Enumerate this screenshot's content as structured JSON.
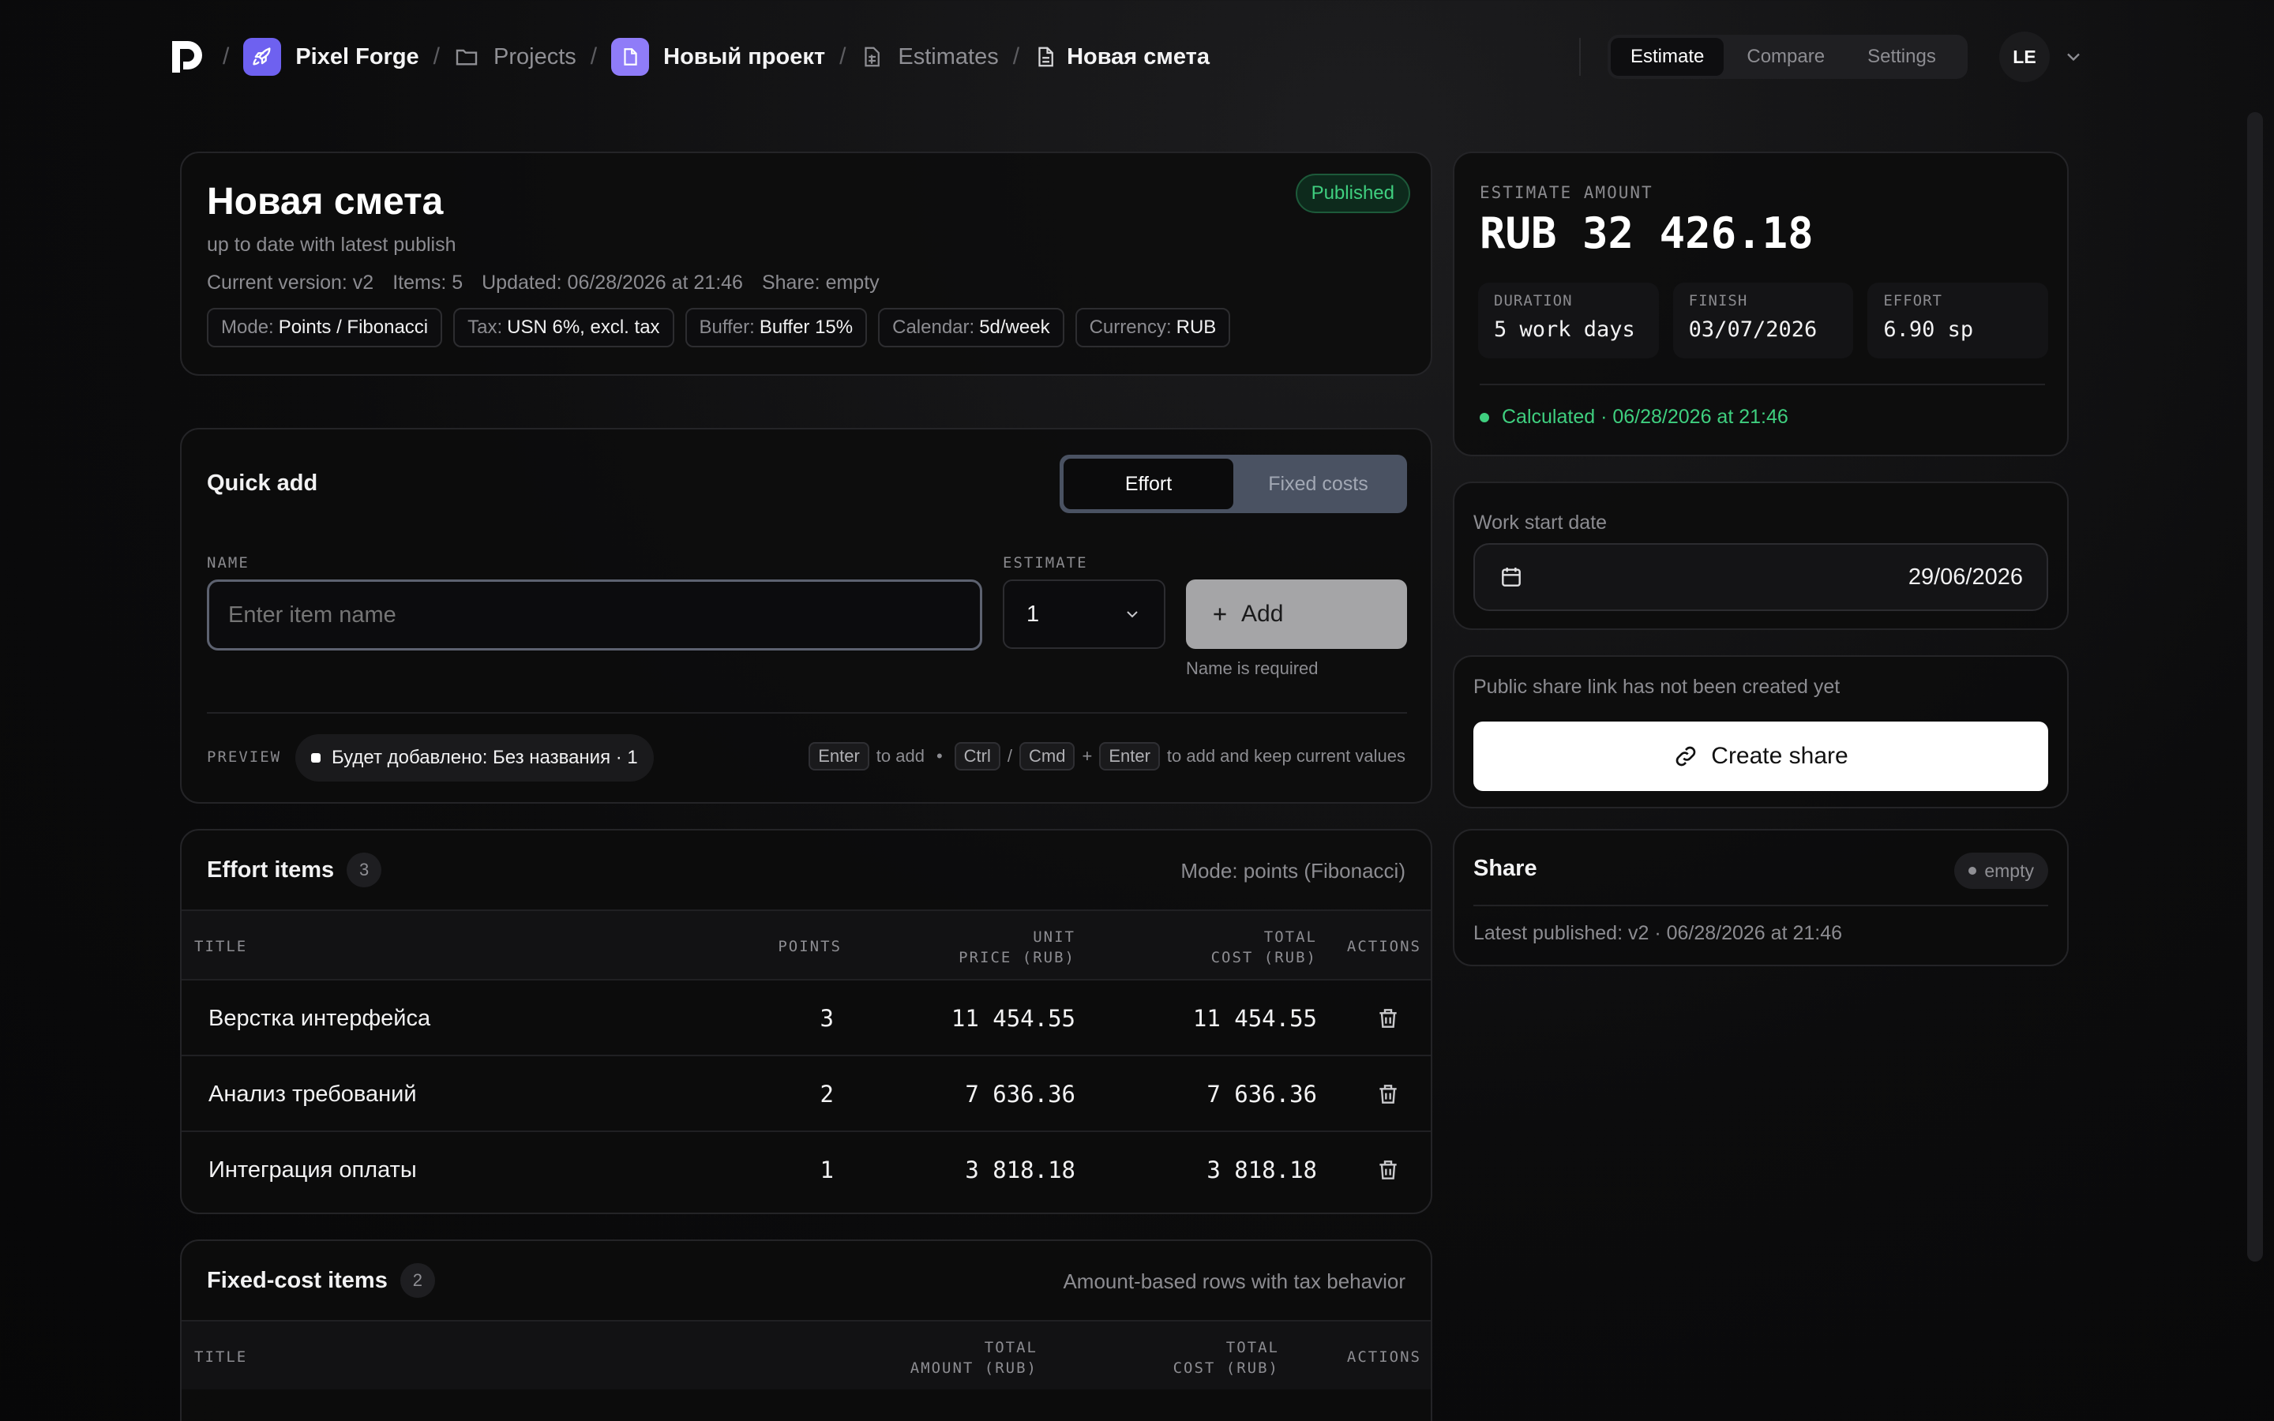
{
  "breadcrumb": {
    "workspace": "Pixel Forge",
    "projects": "Projects",
    "project": "Новый проект",
    "estimates": "Estimates",
    "current": "Новая смета",
    "separator": "/"
  },
  "top_tabs": [
    "Estimate",
    "Compare",
    "Settings"
  ],
  "active_tab": "Estimate",
  "user": {
    "initials": "LE"
  },
  "estimate": {
    "title": "Новая смета",
    "status": "Published",
    "sync_status": "up to date with latest publish",
    "meta": {
      "version": "Current version: v2",
      "items": "Items: 5",
      "updated": "Updated: 06/28/2026 at 21:46",
      "share": "Share: empty"
    },
    "pills": [
      {
        "label": "Mode:",
        "value": "Points / Fibonacci"
      },
      {
        "label": "Tax:",
        "value": "USN 6%, excl. tax"
      },
      {
        "label": "Buffer:",
        "value": "Buffer 15%"
      },
      {
        "label": "Calendar:",
        "value": "5d/week"
      },
      {
        "label": "Currency:",
        "value": "RUB"
      }
    ]
  },
  "quick_add": {
    "title": "Quick add",
    "toggle": [
      "Effort",
      "Fixed costs"
    ],
    "active_toggle": "Effort",
    "name_label": "NAME",
    "name_placeholder": "Enter item name",
    "name_value": "",
    "estimate_label": "ESTIMATE",
    "estimate_value": "1",
    "add_label": "Add",
    "error": "Name is required",
    "preview_label": "PREVIEW",
    "preview_text": "Будет добавлено: Без названия · 1",
    "hint": {
      "enter": "Enter",
      "to_add": "to add",
      "dot": "•",
      "ctrl": "Ctrl",
      "slash": "/",
      "cmd": "Cmd",
      "plus": "+",
      "to_add_keep": "to add and keep current values"
    }
  },
  "effort_items": {
    "title": "Effort items",
    "count": "3",
    "mode": "Mode: points (Fibonacci)",
    "columns": {
      "title": "TITLE",
      "points": "POINTS",
      "unit_price_1": "UNIT",
      "unit_price_2": "PRICE (RUB)",
      "total_cost_1": "TOTAL",
      "total_cost_2": "COST (RUB)",
      "actions": "ACTIONS"
    },
    "rows": [
      {
        "title": "Верстка интерфейса",
        "points": "3",
        "unit_price": "11 454.55",
        "total": "11 454.55"
      },
      {
        "title": "Анализ требований",
        "points": "2",
        "unit_price": "7 636.36",
        "total": "7 636.36"
      },
      {
        "title": "Интеграция оплаты",
        "points": "1",
        "unit_price": "3 818.18",
        "total": "3 818.18"
      }
    ]
  },
  "fixed_items": {
    "title": "Fixed-cost items",
    "count": "2",
    "subtitle": "Amount-based rows with tax behavior",
    "columns": {
      "title": "TITLE",
      "amount_1": "TOTAL",
      "amount_2": "AMOUNT (RUB)",
      "total_1": "TOTAL",
      "total_2": "COST (RUB)",
      "actions": "ACTIONS"
    }
  },
  "summary": {
    "label": "ESTIMATE AMOUNT",
    "amount": "RUB 32 426.18",
    "duration_label": "DURATION",
    "duration": "5 work days",
    "finish_label": "FINISH",
    "finish": "03/07/2026",
    "effort_label": "EFFORT",
    "effort": "6.90 sp",
    "calculated": "Calculated · 06/28/2026 at 21:46"
  },
  "work_start": {
    "label": "Work start date",
    "value": "29/06/2026"
  },
  "share_link": {
    "note": "Public share link has not been created yet",
    "button": "Create share"
  },
  "share": {
    "title": "Share",
    "badge": "empty",
    "latest": "Latest published: v2 · 06/28/2026 at 21:46"
  },
  "colors": {
    "accent_purple": "#7b6cf6",
    "success": "#3fcf7f",
    "background": "#0c0c0d"
  }
}
